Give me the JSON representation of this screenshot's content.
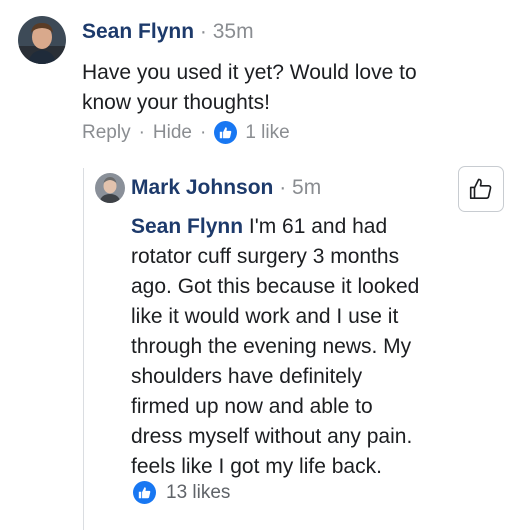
{
  "comment": {
    "author": "Sean Flynn",
    "separator": "·",
    "time": "35m",
    "text_lines": [
      "Have you used it yet? Would love to",
      "know your thoughts!"
    ],
    "actions": {
      "reply": "Reply",
      "hide": "Hide",
      "likes": "1 like"
    }
  },
  "reply": {
    "author": "Mark Johnson",
    "separator": "·",
    "time": "5m",
    "mention": "Sean Flynn",
    "text_lines": [
      " I'm 61 and had",
      "rotator cuff surgery 3 months",
      "ago. Got this because it looked",
      "like it would work and I use it",
      "through the evening news. My",
      "shoulders have definitely",
      "firmed up now and able to",
      "dress myself without any pain.",
      "feels like I got my life back."
    ],
    "likes": "13 likes"
  },
  "colors": {
    "name": "#1d3a6b",
    "meta": "#8a8d91",
    "like_blue": "#1877f2"
  },
  "icons": {
    "like_badge": "thumbs-up-icon",
    "like_button": "thumbs-up-outline-icon"
  }
}
